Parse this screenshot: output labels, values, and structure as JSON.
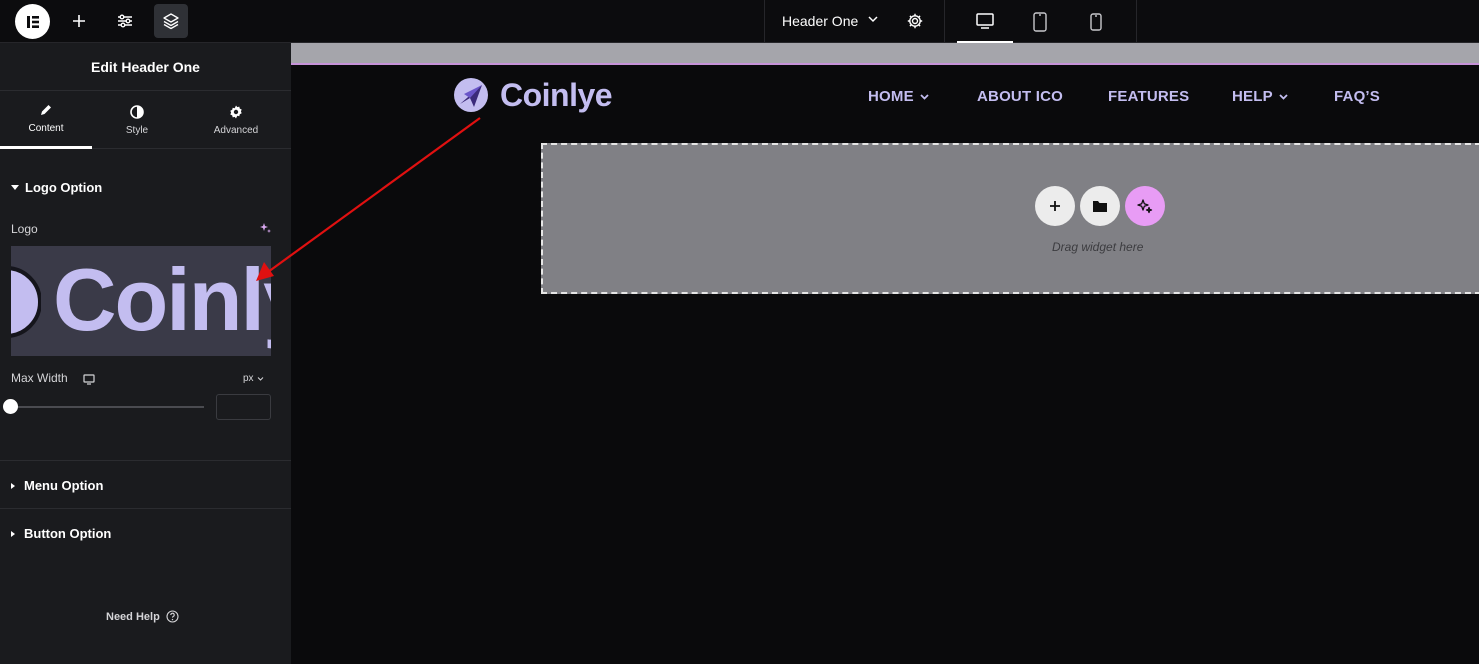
{
  "topbar": {
    "document_title": "Header One"
  },
  "panel": {
    "title": "Edit Header One",
    "tabs": [
      {
        "label": "Content"
      },
      {
        "label": "Style"
      },
      {
        "label": "Advanced"
      }
    ],
    "logo_section": {
      "heading": "Logo Option",
      "logo_label": "Logo",
      "preview_text": "Coinly",
      "max_width_label": "Max Width",
      "unit": "px",
      "max_width_value": ""
    },
    "menu_section": {
      "heading": "Menu Option"
    },
    "button_section": {
      "heading": "Button Option"
    },
    "need_help": "Need Help"
  },
  "site": {
    "brand_name": "Coinlye",
    "nav": [
      {
        "label": "HOME"
      },
      {
        "label": "ABOUT ICO"
      },
      {
        "label": "FEATURES"
      },
      {
        "label": "HELP"
      },
      {
        "label": "FAQ’S"
      }
    ],
    "drop_text": "Drag widget here"
  },
  "colors": {
    "accent_pink": "#e89cf5",
    "brand_lavender": "#c3bdf0",
    "annotation_arrow": "#e01010"
  }
}
